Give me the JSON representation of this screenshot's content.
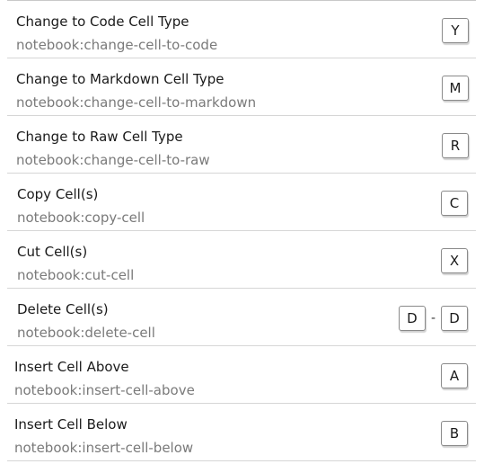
{
  "shortcuts": [
    {
      "title": "Change to Code Cell Type",
      "command": "notebook:change-cell-to-code",
      "keys": [
        "Y"
      ]
    },
    {
      "title": "Change to Markdown Cell Type",
      "command": "notebook:change-cell-to-markdown",
      "keys": [
        "M"
      ]
    },
    {
      "title": "Change to Raw Cell Type",
      "command": "notebook:change-cell-to-raw",
      "keys": [
        "R"
      ]
    },
    {
      "title": "Copy Cell(s)",
      "command": "notebook:copy-cell",
      "keys": [
        "C"
      ]
    },
    {
      "title": "Cut Cell(s)",
      "command": "notebook:cut-cell",
      "keys": [
        "X"
      ]
    },
    {
      "title": "Delete Cell(s)",
      "command": "notebook:delete-cell",
      "keys": [
        "D",
        "D"
      ],
      "key_separator": "-"
    },
    {
      "title": "Insert Cell Above",
      "command": "notebook:insert-cell-above",
      "keys": [
        "A"
      ]
    },
    {
      "title": "Insert Cell Below",
      "command": "notebook:insert-cell-below",
      "keys": [
        "B"
      ]
    }
  ]
}
